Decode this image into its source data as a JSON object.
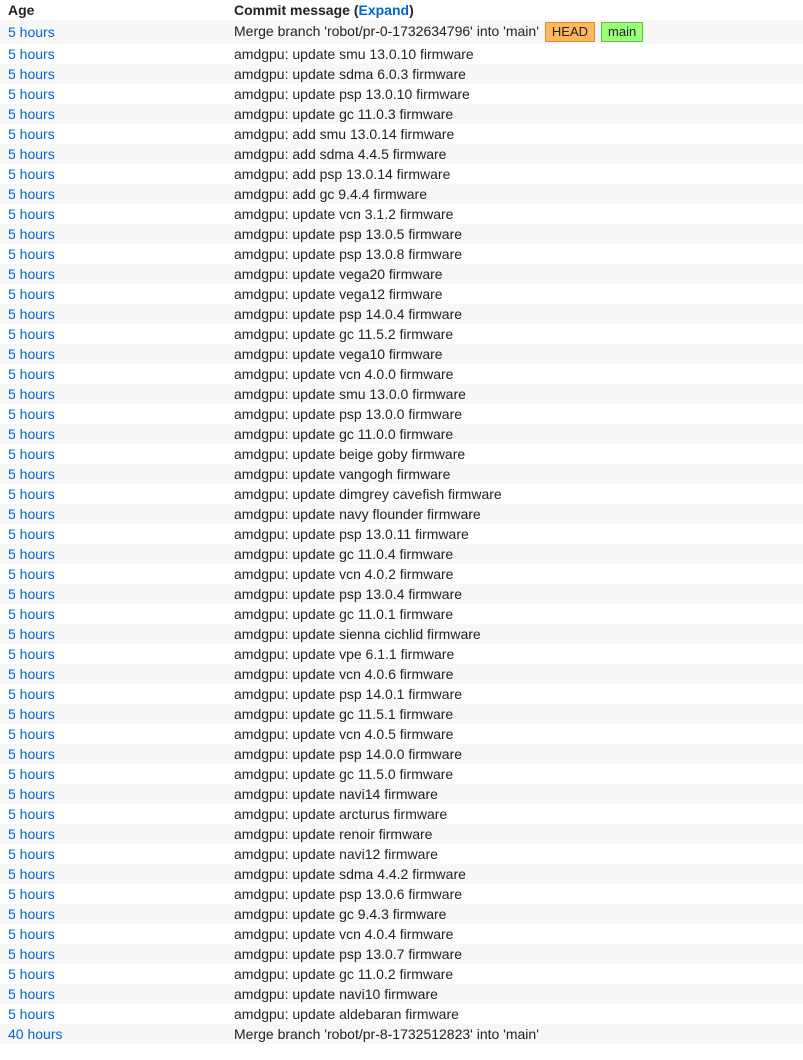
{
  "header": {
    "age_label": "Age",
    "commit_prefix": "Commit message (",
    "expand_label": "Expand",
    "commit_suffix": ")"
  },
  "tags": {
    "head": "HEAD",
    "main": "main"
  },
  "rows": [
    {
      "age": "5 hours",
      "msg": "Merge branch 'robot/pr-0-1732634796' into 'main'",
      "head": true,
      "main": true
    },
    {
      "age": "5 hours",
      "msg": "amdgpu: update smu 13.0.10 firmware"
    },
    {
      "age": "5 hours",
      "msg": "amdgpu: update sdma 6.0.3 firmware"
    },
    {
      "age": "5 hours",
      "msg": "amdgpu: update psp 13.0.10 firmware"
    },
    {
      "age": "5 hours",
      "msg": "amdgpu: update gc 11.0.3 firmware"
    },
    {
      "age": "5 hours",
      "msg": "amdgpu: add smu 13.0.14 firmware"
    },
    {
      "age": "5 hours",
      "msg": "amdgpu: add sdma 4.4.5 firmware"
    },
    {
      "age": "5 hours",
      "msg": "amdgpu: add psp 13.0.14 firmware"
    },
    {
      "age": "5 hours",
      "msg": "amdgpu: add gc 9.4.4 firmware"
    },
    {
      "age": "5 hours",
      "msg": "amdgpu: update vcn 3.1.2 firmware"
    },
    {
      "age": "5 hours",
      "msg": "amdgpu: update psp 13.0.5 firmware"
    },
    {
      "age": "5 hours",
      "msg": "amdgpu: update psp 13.0.8 firmware"
    },
    {
      "age": "5 hours",
      "msg": "amdgpu: update vega20 firmware"
    },
    {
      "age": "5 hours",
      "msg": "amdgpu: update vega12 firmware"
    },
    {
      "age": "5 hours",
      "msg": "amdgpu: update psp 14.0.4 firmware"
    },
    {
      "age": "5 hours",
      "msg": "amdgpu: update gc 11.5.2 firmware"
    },
    {
      "age": "5 hours",
      "msg": "amdgpu: update vega10 firmware"
    },
    {
      "age": "5 hours",
      "msg": "amdgpu: update vcn 4.0.0 firmware"
    },
    {
      "age": "5 hours",
      "msg": "amdgpu: update smu 13.0.0 firmware"
    },
    {
      "age": "5 hours",
      "msg": "amdgpu: update psp 13.0.0 firmware"
    },
    {
      "age": "5 hours",
      "msg": "amdgpu: update gc 11.0.0 firmware"
    },
    {
      "age": "5 hours",
      "msg": "amdgpu: update beige goby firmware"
    },
    {
      "age": "5 hours",
      "msg": "amdgpu: update vangogh firmware"
    },
    {
      "age": "5 hours",
      "msg": "amdgpu: update dimgrey cavefish firmware"
    },
    {
      "age": "5 hours",
      "msg": "amdgpu: update navy flounder firmware"
    },
    {
      "age": "5 hours",
      "msg": "amdgpu: update psp 13.0.11 firmware"
    },
    {
      "age": "5 hours",
      "msg": "amdgpu: update gc 11.0.4 firmware"
    },
    {
      "age": "5 hours",
      "msg": "amdgpu: update vcn 4.0.2 firmware"
    },
    {
      "age": "5 hours",
      "msg": "amdgpu: update psp 13.0.4 firmware"
    },
    {
      "age": "5 hours",
      "msg": "amdgpu: update gc 11.0.1 firmware"
    },
    {
      "age": "5 hours",
      "msg": "amdgpu: update sienna cichlid firmware"
    },
    {
      "age": "5 hours",
      "msg": "amdgpu: update vpe 6.1.1 firmware"
    },
    {
      "age": "5 hours",
      "msg": "amdgpu: update vcn 4.0.6 firmware"
    },
    {
      "age": "5 hours",
      "msg": "amdgpu: update psp 14.0.1 firmware"
    },
    {
      "age": "5 hours",
      "msg": "amdgpu: update gc 11.5.1 firmware"
    },
    {
      "age": "5 hours",
      "msg": "amdgpu: update vcn 4.0.5 firmware"
    },
    {
      "age": "5 hours",
      "msg": "amdgpu: update psp 14.0.0 firmware"
    },
    {
      "age": "5 hours",
      "msg": "amdgpu: update gc 11.5.0 firmware"
    },
    {
      "age": "5 hours",
      "msg": "amdgpu: update navi14 firmware"
    },
    {
      "age": "5 hours",
      "msg": "amdgpu: update arcturus firmware"
    },
    {
      "age": "5 hours",
      "msg": "amdgpu: update renoir firmware"
    },
    {
      "age": "5 hours",
      "msg": "amdgpu: update navi12 firmware"
    },
    {
      "age": "5 hours",
      "msg": "amdgpu: update sdma 4.4.2 firmware"
    },
    {
      "age": "5 hours",
      "msg": "amdgpu: update psp 13.0.6 firmware"
    },
    {
      "age": "5 hours",
      "msg": "amdgpu: update gc 9.4.3 firmware"
    },
    {
      "age": "5 hours",
      "msg": "amdgpu: update vcn 4.0.4 firmware"
    },
    {
      "age": "5 hours",
      "msg": "amdgpu: update psp 13.0.7 firmware"
    },
    {
      "age": "5 hours",
      "msg": "amdgpu: update gc 11.0.2 firmware"
    },
    {
      "age": "5 hours",
      "msg": "amdgpu: update navi10 firmware"
    },
    {
      "age": "5 hours",
      "msg": "amdgpu: update aldebaran firmware"
    },
    {
      "age": "40 hours",
      "msg": "Merge branch 'robot/pr-8-1732512823' into 'main'"
    }
  ]
}
